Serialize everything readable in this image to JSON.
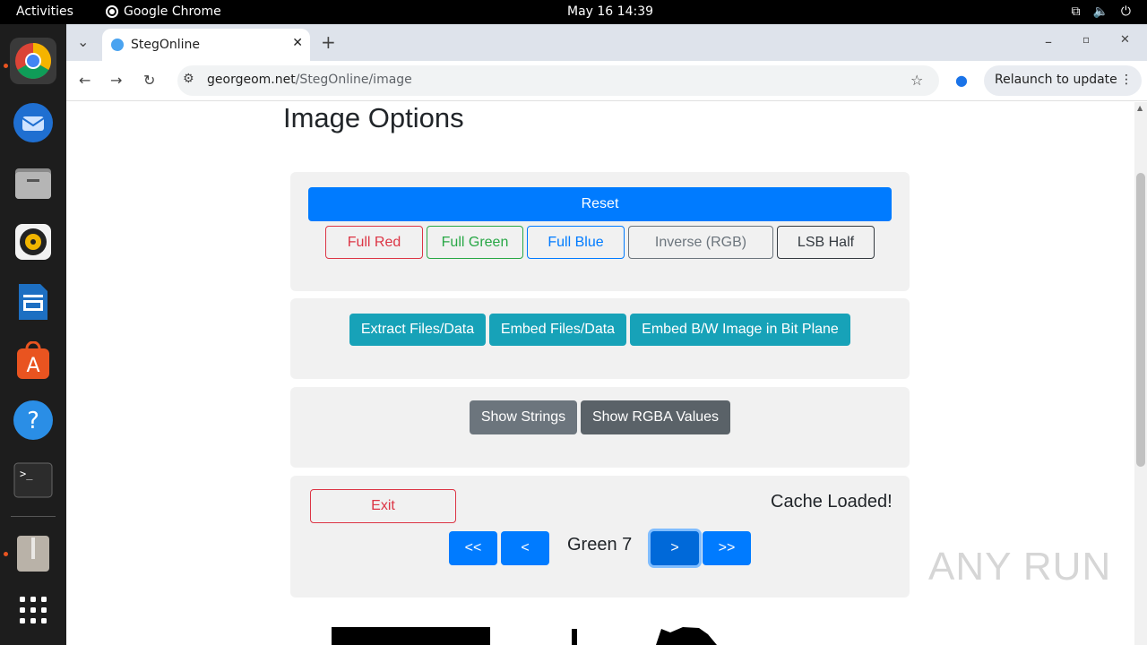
{
  "system": {
    "activities": "Activities",
    "app_name": "Google Chrome",
    "clock": "May 16  14:39"
  },
  "dock": {
    "items": [
      "chrome-icon",
      "thunderbird-icon",
      "files-icon",
      "rhythmbox-icon",
      "writer-icon",
      "app-center-icon",
      "help-icon",
      "terminal-icon",
      "archive-icon",
      "show-apps-icon"
    ]
  },
  "browser": {
    "tab_title": "StegOnline",
    "url_host": "georgeom.net",
    "url_path": "/StegOnline/image",
    "relaunch_label": "Relaunch to update"
  },
  "page": {
    "heading": "Image Options",
    "reset_label": "Reset",
    "color_buttons": {
      "full_red": "Full Red",
      "full_green": "Full Green",
      "full_blue": "Full Blue",
      "inverse": "Inverse (RGB)",
      "lsb_half": "LSB Half"
    },
    "data_buttons": {
      "extract": "Extract Files/Data",
      "embed": "Embed Files/Data",
      "embed_bw": "Embed B/W Image in Bit Plane"
    },
    "view_buttons": {
      "strings": "Show Strings",
      "rgba": "Show RGBA Values"
    },
    "nav": {
      "exit": "Exit",
      "status": "Cache Loaded!",
      "first": "<<",
      "prev": "<",
      "current": "Green 7",
      "next": ">",
      "last": ">>"
    }
  },
  "watermark": "ANY RUN"
}
